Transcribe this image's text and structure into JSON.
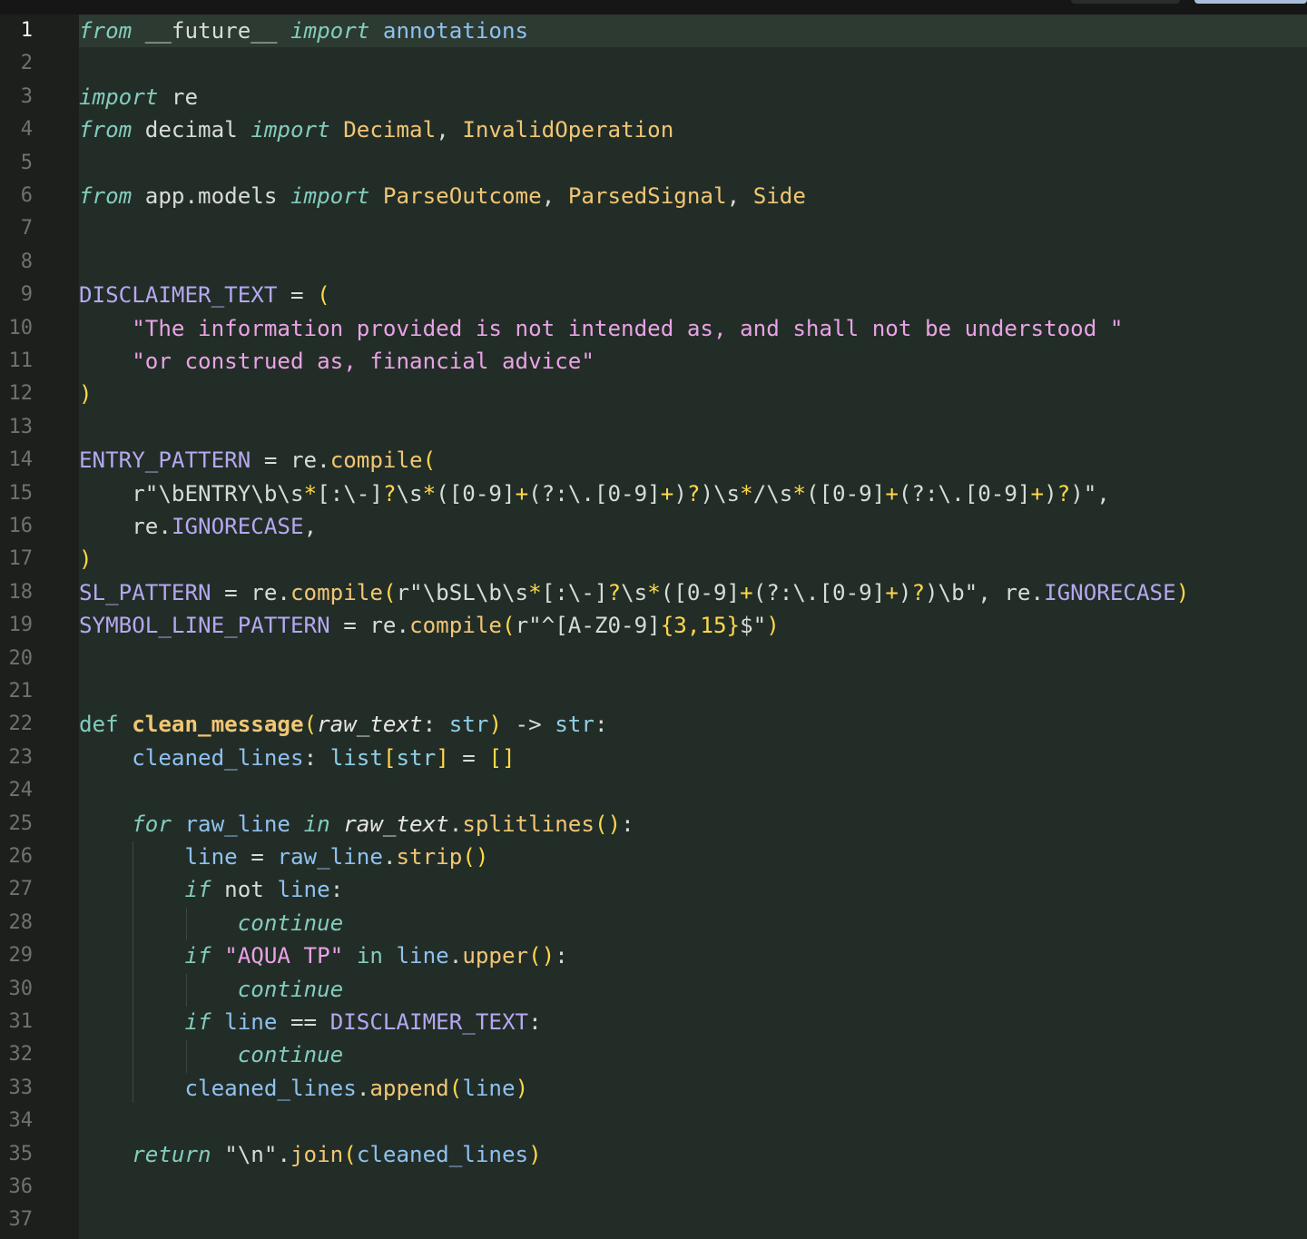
{
  "editor": {
    "active_line": 1,
    "colors": {
      "background": "#232d27",
      "gutter": "#1d1f1d",
      "current_line": "#2c3a31",
      "line_number": "#6d736e",
      "line_number_active": "#f2f2f2",
      "keyword": "#82cdbd",
      "module": "#d8dcd6",
      "class": "#f0c674",
      "constant": "#b4a8f0",
      "string": "#e8a3e5",
      "function": "#f0c674",
      "bracket": "#ffd84a",
      "variable": "#8fc1f0",
      "parameter": "#e6e6e6",
      "builtin_type": "#8fd0e6",
      "plain": "#d8dcd6"
    },
    "lines": [
      {
        "n": "1",
        "tokens": [
          {
            "t": "from",
            "c": "kw-it"
          },
          {
            "t": " __future__ ",
            "c": "plain"
          },
          {
            "t": "import",
            "c": "kw-it"
          },
          {
            "t": " annotations",
            "c": "var"
          }
        ]
      },
      {
        "n": "2",
        "tokens": []
      },
      {
        "n": "3",
        "tokens": [
          {
            "t": "import",
            "c": "kw-it"
          },
          {
            "t": " re",
            "c": "plain"
          }
        ]
      },
      {
        "n": "4",
        "tokens": [
          {
            "t": "from",
            "c": "kw-it"
          },
          {
            "t": " decimal ",
            "c": "plain"
          },
          {
            "t": "import",
            "c": "kw-it"
          },
          {
            "t": " Decimal",
            "c": "cls"
          },
          {
            "t": ", ",
            "c": "plain"
          },
          {
            "t": "InvalidOperation",
            "c": "cls"
          }
        ]
      },
      {
        "n": "5",
        "tokens": []
      },
      {
        "n": "6",
        "tokens": [
          {
            "t": "from",
            "c": "kw-it"
          },
          {
            "t": " app.models ",
            "c": "plain"
          },
          {
            "t": "import",
            "c": "kw-it"
          },
          {
            "t": " ParseOutcome",
            "c": "cls"
          },
          {
            "t": ", ",
            "c": "plain"
          },
          {
            "t": "ParsedSignal",
            "c": "cls"
          },
          {
            "t": ", ",
            "c": "plain"
          },
          {
            "t": "Side",
            "c": "cls"
          }
        ]
      },
      {
        "n": "7",
        "tokens": []
      },
      {
        "n": "8",
        "tokens": []
      },
      {
        "n": "9",
        "tokens": [
          {
            "t": "DISCLAIMER_TEXT",
            "c": "const"
          },
          {
            "t": " = ",
            "c": "plain"
          },
          {
            "t": "(",
            "c": "brk"
          }
        ]
      },
      {
        "n": "10",
        "tokens": [
          {
            "t": "    ",
            "c": "plain"
          },
          {
            "t": "\"The information provided is not intended as, and shall not be understood \"",
            "c": "str"
          }
        ]
      },
      {
        "n": "11",
        "tokens": [
          {
            "t": "    ",
            "c": "plain"
          },
          {
            "t": "\"or construed as, financial advice\"",
            "c": "str"
          }
        ]
      },
      {
        "n": "12",
        "tokens": [
          {
            "t": ")",
            "c": "brk"
          }
        ]
      },
      {
        "n": "13",
        "tokens": []
      },
      {
        "n": "14",
        "tokens": [
          {
            "t": "ENTRY_PATTERN",
            "c": "const"
          },
          {
            "t": " = re.",
            "c": "plain"
          },
          {
            "t": "compile",
            "c": "fn"
          },
          {
            "t": "(",
            "c": "brk"
          }
        ]
      },
      {
        "n": "15",
        "tokens": [
          {
            "t": "    r\"\\bENTRY\\b\\s",
            "c": "plain"
          },
          {
            "t": "*",
            "c": "brk"
          },
          {
            "t": "[:\\-]",
            "c": "plain"
          },
          {
            "t": "?",
            "c": "brk"
          },
          {
            "t": "\\s",
            "c": "plain"
          },
          {
            "t": "*",
            "c": "brk"
          },
          {
            "t": "([0-9]",
            "c": "plain"
          },
          {
            "t": "+",
            "c": "brk"
          },
          {
            "t": "(?:\\.[0-9]",
            "c": "plain"
          },
          {
            "t": "+",
            "c": "brk"
          },
          {
            "t": ")",
            "c": "plain"
          },
          {
            "t": "?",
            "c": "brk"
          },
          {
            "t": ")\\s",
            "c": "plain"
          },
          {
            "t": "*",
            "c": "brk"
          },
          {
            "t": "/\\s",
            "c": "plain"
          },
          {
            "t": "*",
            "c": "brk"
          },
          {
            "t": "([0-9]",
            "c": "plain"
          },
          {
            "t": "+",
            "c": "brk"
          },
          {
            "t": "(?:\\.[0-9]",
            "c": "plain"
          },
          {
            "t": "+",
            "c": "brk"
          },
          {
            "t": ")",
            "c": "plain"
          },
          {
            "t": "?",
            "c": "brk"
          },
          {
            "t": ")\",",
            "c": "plain"
          }
        ]
      },
      {
        "n": "16",
        "tokens": [
          {
            "t": "    re.",
            "c": "plain"
          },
          {
            "t": "IGNORECASE",
            "c": "const"
          },
          {
            "t": ",",
            "c": "plain"
          }
        ]
      },
      {
        "n": "17",
        "tokens": [
          {
            "t": ")",
            "c": "brk"
          }
        ]
      },
      {
        "n": "18",
        "tokens": [
          {
            "t": "SL_PATTERN",
            "c": "const"
          },
          {
            "t": " = re.",
            "c": "plain"
          },
          {
            "t": "compile",
            "c": "fn"
          },
          {
            "t": "(",
            "c": "brk"
          },
          {
            "t": "r\"\\bSL\\b\\s",
            "c": "plain"
          },
          {
            "t": "*",
            "c": "brk"
          },
          {
            "t": "[:\\-]",
            "c": "plain"
          },
          {
            "t": "?",
            "c": "brk"
          },
          {
            "t": "\\s",
            "c": "plain"
          },
          {
            "t": "*",
            "c": "brk"
          },
          {
            "t": "([0-9]",
            "c": "plain"
          },
          {
            "t": "+",
            "c": "brk"
          },
          {
            "t": "(?:\\.[0-9]",
            "c": "plain"
          },
          {
            "t": "+",
            "c": "brk"
          },
          {
            "t": ")",
            "c": "plain"
          },
          {
            "t": "?",
            "c": "brk"
          },
          {
            "t": ")\\b\", re.",
            "c": "plain"
          },
          {
            "t": "IGNORECASE",
            "c": "const"
          },
          {
            "t": ")",
            "c": "brk"
          }
        ]
      },
      {
        "n": "19",
        "tokens": [
          {
            "t": "SYMBOL_LINE_PATTERN",
            "c": "const"
          },
          {
            "t": " = re.",
            "c": "plain"
          },
          {
            "t": "compile",
            "c": "fn"
          },
          {
            "t": "(",
            "c": "brk"
          },
          {
            "t": "r\"^[A-Z0-9]",
            "c": "plain"
          },
          {
            "t": "{3,15}",
            "c": "brk"
          },
          {
            "t": "$\"",
            "c": "plain"
          },
          {
            "t": ")",
            "c": "brk"
          }
        ]
      },
      {
        "n": "20",
        "tokens": []
      },
      {
        "n": "21",
        "tokens": []
      },
      {
        "n": "22",
        "tokens": [
          {
            "t": "def",
            "c": "kw"
          },
          {
            "t": " ",
            "c": "plain"
          },
          {
            "t": "clean_message",
            "c": "fn-b"
          },
          {
            "t": "(",
            "c": "brk"
          },
          {
            "t": "raw_text",
            "c": "param"
          },
          {
            "t": ": ",
            "c": "plain"
          },
          {
            "t": "str",
            "c": "type"
          },
          {
            "t": ")",
            "c": "brk"
          },
          {
            "t": " -> ",
            "c": "plain"
          },
          {
            "t": "str",
            "c": "type"
          },
          {
            "t": ":",
            "c": "plain"
          }
        ]
      },
      {
        "n": "23",
        "tokens": [
          {
            "t": "    ",
            "c": "plain"
          },
          {
            "t": "cleaned_lines",
            "c": "var"
          },
          {
            "t": ": ",
            "c": "plain"
          },
          {
            "t": "list",
            "c": "type"
          },
          {
            "t": "[",
            "c": "brk"
          },
          {
            "t": "str",
            "c": "type"
          },
          {
            "t": "]",
            "c": "brk"
          },
          {
            "t": " = ",
            "c": "plain"
          },
          {
            "t": "[]",
            "c": "brk"
          }
        ]
      },
      {
        "n": "24",
        "tokens": []
      },
      {
        "n": "25",
        "tokens": [
          {
            "t": "    ",
            "c": "plain"
          },
          {
            "t": "for",
            "c": "kw-it"
          },
          {
            "t": " ",
            "c": "plain"
          },
          {
            "t": "raw_line",
            "c": "var"
          },
          {
            "t": " ",
            "c": "plain"
          },
          {
            "t": "in",
            "c": "kw-it"
          },
          {
            "t": " ",
            "c": "plain"
          },
          {
            "t": "raw_text",
            "c": "param"
          },
          {
            "t": ".",
            "c": "plain"
          },
          {
            "t": "splitlines",
            "c": "fn"
          },
          {
            "t": "()",
            "c": "brk"
          },
          {
            "t": ":",
            "c": "plain"
          }
        ]
      },
      {
        "n": "26",
        "tokens": [
          {
            "t": "        ",
            "c": "plain"
          },
          {
            "t": "line",
            "c": "var"
          },
          {
            "t": " = ",
            "c": "plain"
          },
          {
            "t": "raw_line",
            "c": "var"
          },
          {
            "t": ".",
            "c": "plain"
          },
          {
            "t": "strip",
            "c": "fn"
          },
          {
            "t": "()",
            "c": "brk"
          }
        ]
      },
      {
        "n": "27",
        "tokens": [
          {
            "t": "        ",
            "c": "plain"
          },
          {
            "t": "if",
            "c": "kw-it"
          },
          {
            "t": " not ",
            "c": "plain"
          },
          {
            "t": "line",
            "c": "var"
          },
          {
            "t": ":",
            "c": "plain"
          }
        ]
      },
      {
        "n": "28",
        "tokens": [
          {
            "t": "            ",
            "c": "plain"
          },
          {
            "t": "continue",
            "c": "kw-it"
          }
        ]
      },
      {
        "n": "29",
        "tokens": [
          {
            "t": "        ",
            "c": "plain"
          },
          {
            "t": "if",
            "c": "kw-it"
          },
          {
            "t": " ",
            "c": "plain"
          },
          {
            "t": "\"AQUA TP\"",
            "c": "str"
          },
          {
            "t": " ",
            "c": "plain"
          },
          {
            "t": "in",
            "c": "kw"
          },
          {
            "t": " ",
            "c": "plain"
          },
          {
            "t": "line",
            "c": "var"
          },
          {
            "t": ".",
            "c": "plain"
          },
          {
            "t": "upper",
            "c": "fn"
          },
          {
            "t": "()",
            "c": "brk"
          },
          {
            "t": ":",
            "c": "plain"
          }
        ]
      },
      {
        "n": "30",
        "tokens": [
          {
            "t": "            ",
            "c": "plain"
          },
          {
            "t": "continue",
            "c": "kw-it"
          }
        ]
      },
      {
        "n": "31",
        "tokens": [
          {
            "t": "        ",
            "c": "plain"
          },
          {
            "t": "if",
            "c": "kw-it"
          },
          {
            "t": " ",
            "c": "plain"
          },
          {
            "t": "line",
            "c": "var"
          },
          {
            "t": " == ",
            "c": "plain"
          },
          {
            "t": "DISCLAIMER_TEXT",
            "c": "const"
          },
          {
            "t": ":",
            "c": "plain"
          }
        ]
      },
      {
        "n": "32",
        "tokens": [
          {
            "t": "            ",
            "c": "plain"
          },
          {
            "t": "continue",
            "c": "kw-it"
          }
        ]
      },
      {
        "n": "33",
        "tokens": [
          {
            "t": "        ",
            "c": "plain"
          },
          {
            "t": "cleaned_lines",
            "c": "var"
          },
          {
            "t": ".",
            "c": "plain"
          },
          {
            "t": "append",
            "c": "fn"
          },
          {
            "t": "(",
            "c": "brk"
          },
          {
            "t": "line",
            "c": "var"
          },
          {
            "t": ")",
            "c": "brk"
          }
        ]
      },
      {
        "n": "34",
        "tokens": []
      },
      {
        "n": "35",
        "tokens": [
          {
            "t": "    ",
            "c": "plain"
          },
          {
            "t": "return",
            "c": "kw-it"
          },
          {
            "t": " ",
            "c": "plain"
          },
          {
            "t": "\"\\n\"",
            "c": "plain"
          },
          {
            "t": ".",
            "c": "plain"
          },
          {
            "t": "join",
            "c": "fn"
          },
          {
            "t": "(",
            "c": "brk"
          },
          {
            "t": "cleaned_lines",
            "c": "var"
          },
          {
            "t": ")",
            "c": "brk"
          }
        ]
      },
      {
        "n": "36",
        "tokens": []
      },
      {
        "n": "37",
        "tokens": []
      }
    ]
  }
}
